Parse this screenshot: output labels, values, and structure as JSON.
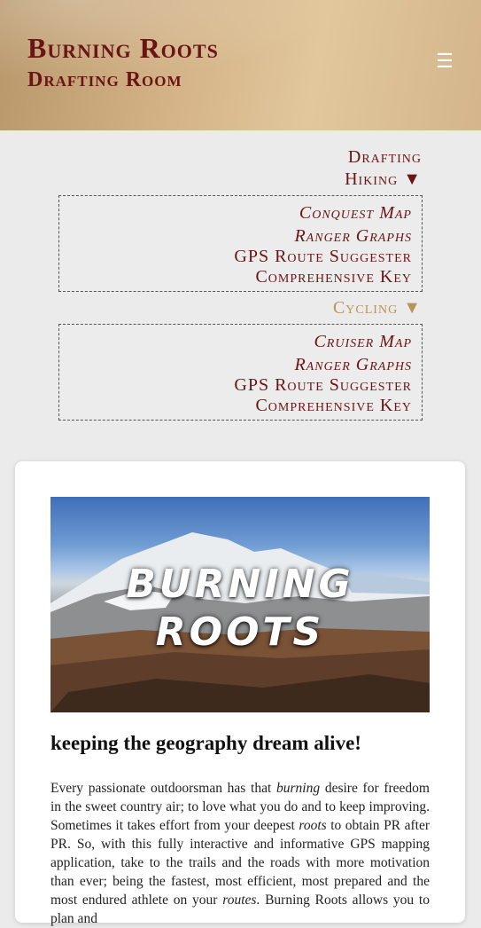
{
  "brand": {
    "title": "Burning Roots",
    "subtitle": "Drafting Room"
  },
  "menu_icon": "hamburger-menu-icon",
  "nav": {
    "drafting": "Drafting",
    "hiking": {
      "label": "Hiking ▼",
      "items": [
        "Conquest Map",
        "Ranger Graphs",
        "GPS Route Suggester",
        "Comprehensive Key"
      ]
    },
    "cycling": {
      "label": "Cycling ▼",
      "items": [
        "Cruiser Map",
        "Ranger Graphs",
        "GPS Route Suggester",
        "Comprehensive Key"
      ]
    }
  },
  "hero": {
    "line1": "Burning",
    "line2": "Roots"
  },
  "article": {
    "headline": "keeping the geography dream alive!",
    "p1": "Every passionate outdoorsman has that ",
    "e1": "burning",
    "p2": " desire for freedom in the sweet country air; to love what you do and to keep improving. Sometimes it takes effort from your deepest ",
    "e2": "roots",
    "p3": " to obtain PR after PR. So, with this fully interactive and informative GPS mapping application, take to the trails and the roads with more motivation than ever; being the fastest, most efficient, most prepared and the most endured athlete on your ",
    "e3": "routes",
    "p4": ". Burning Roots allows you to plan and"
  },
  "colors": {
    "accent": "#6b1414",
    "gold": "#b8935a",
    "header": "#d2b185"
  }
}
